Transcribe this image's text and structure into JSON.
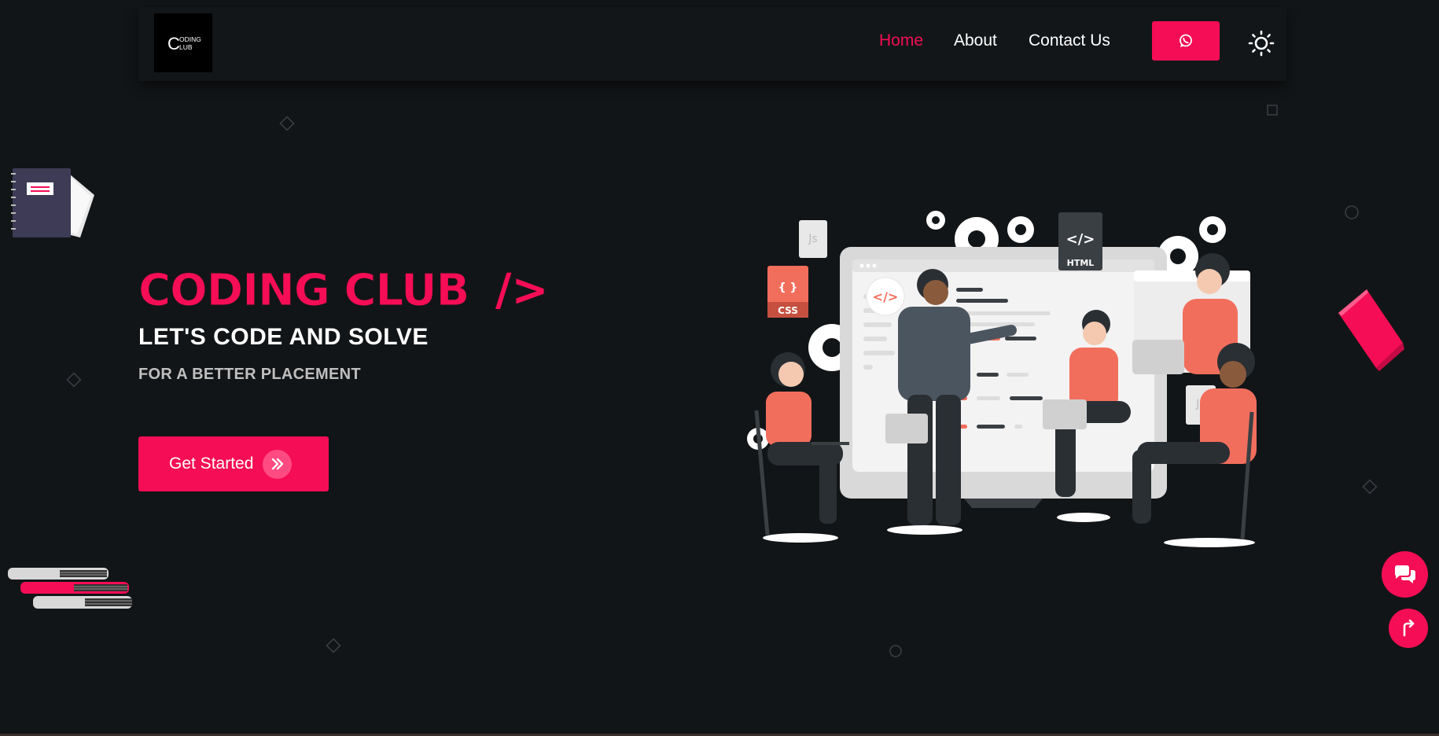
{
  "brand": {
    "logo_text_line1": "ODING",
    "logo_text_line2": "LUB",
    "logo_initial": "C"
  },
  "nav": {
    "items": [
      {
        "label": "Home",
        "active": true
      },
      {
        "label": "About",
        "active": false
      },
      {
        "label": "Contact Us",
        "active": false
      }
    ],
    "whatsapp_icon": "whatsapp-icon",
    "theme_icon": "sun-icon"
  },
  "hero": {
    "title": "CODING CLUB",
    "title_symbol": "/>",
    "subtitle": "LET'S CODE AND SOLVE",
    "tagline": "FOR A BETTER PLACEMENT",
    "cta_label": "Get Started",
    "cta_icon": "double-chevron-right-icon"
  },
  "illustration": {
    "badges": [
      "Js",
      "CSS",
      "HTML",
      "</>",
      "{ }"
    ]
  },
  "floating": {
    "chat_icon": "chat-icon",
    "scroll_top_icon": "arrow-up-icon"
  },
  "colors": {
    "accent": "#f50d55",
    "background": "#121517",
    "coral": "#f26e5c"
  }
}
